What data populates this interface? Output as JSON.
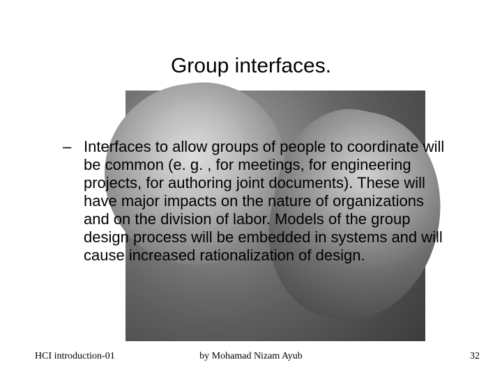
{
  "title": "Group interfaces.",
  "bullet_dash": "–",
  "body": "Interfaces to allow groups of people to coordinate will be common (e. g. , for meetings, for engineering projects, for authoring joint documents). These will have major impacts on the nature of organizations and on the division of labor. Models of the group design process will be embedded in systems and will cause increased rationalization of design.",
  "footer": {
    "left": "HCI introduction-01",
    "center": "by Mohamad Nizam Ayub",
    "right": "32"
  }
}
